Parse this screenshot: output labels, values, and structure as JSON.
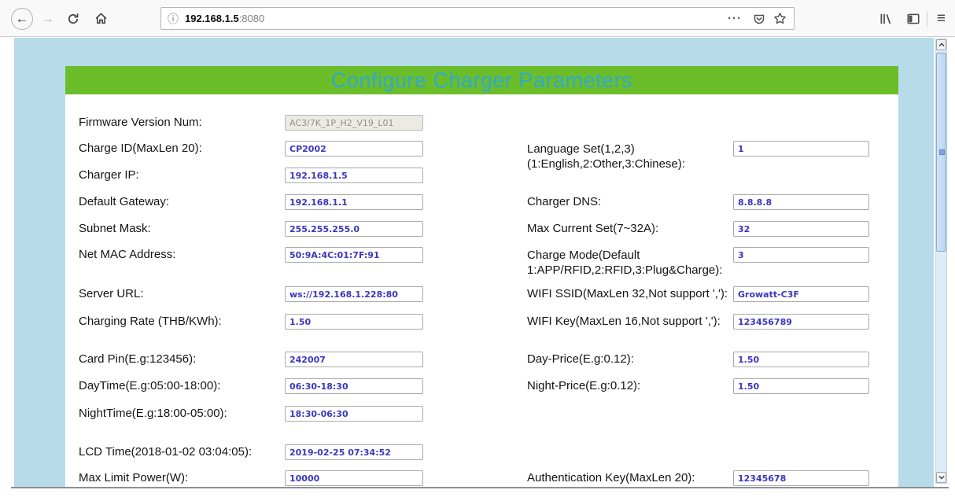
{
  "browser": {
    "url": {
      "host": "192.168.1.5",
      "port": ":8080"
    },
    "page_actions_label": "···",
    "back_glyph": "←",
    "forward_glyph": "→",
    "menu_glyph": "≡",
    "info_glyph": "ⓘ"
  },
  "page": {
    "title": "Configure Charger Parameters",
    "colors": {
      "header_green": "#6cbd2a",
      "title_text": "#2fa9ce",
      "page_background": "#b7dbe9",
      "input_text": "#3b36bd"
    }
  },
  "form": {
    "left_rows": [
      {
        "label": "Firmware Version Num:",
        "value": "AC3/7K_1P_H2_V19_L01",
        "disabled": true
      },
      {
        "label": "Charge ID(MaxLen 20):",
        "value": "CP2002"
      },
      {
        "label": "Charger IP:",
        "value": "192.168.1.5"
      },
      {
        "label": "Default Gateway:",
        "value": "192.168.1.1"
      },
      {
        "label": "Subnet Mask:",
        "value": "255.255.255.0"
      },
      {
        "label": "Net MAC Address:",
        "value": "50:9A:4C:01:7F:91"
      },
      {
        "label": "Server URL:",
        "value": "ws://192.168.1.228:80"
      },
      {
        "label": "Charging Rate (THB/KWh):",
        "value": "1.50"
      },
      {
        "label": "Card Pin(E.g:123456):",
        "value": "242007"
      },
      {
        "label": "DayTime(E.g:05:00-18:00):",
        "value": "06:30-18:30"
      },
      {
        "label": "NightTime(E.g:18:00-05:00):",
        "value": "18:30-06:30"
      },
      {
        "label": "LCD Time(2018-01-02 03:04:05):",
        "value": "2019-02-25 07:34:52"
      },
      {
        "label": "Max Limit Power(W):",
        "value": "10000"
      }
    ],
    "right_rows": [
      {
        "label_line1": "Language Set(1,2,3)",
        "label_line2": "(1:English,2:Other,3:Chinese):",
        "value": "1"
      },
      {
        "label_line1": "Charger DNS:",
        "label_line2": "",
        "value": "8.8.8.8"
      },
      {
        "label_line1": "Max Current Set(7~32A):",
        "label_line2": "",
        "value": "32"
      },
      {
        "label_line1": "Charge Mode(Default",
        "label_line2": "1:APP/RFID,2:RFID,3:Plug&Charge):",
        "value": "3"
      },
      {
        "label_line1": "WIFI SSID(MaxLen 32,Not support ','):",
        "label_line2": "",
        "value": "Growatt-C3F"
      },
      {
        "label_line1": "WIFI Key(MaxLen 16,Not support ','):",
        "label_line2": "",
        "value": "123456789"
      },
      {
        "label_line1": "Day-Price(E.g:0.12):",
        "label_line2": "",
        "value": "1.50"
      },
      {
        "label_line1": "Night-Price(E.g:0.12):",
        "label_line2": "",
        "value": "1.50"
      },
      {
        "label_line1": "Authentication Key(MaxLen 20):",
        "label_line2": "",
        "value": "12345678"
      }
    ]
  }
}
